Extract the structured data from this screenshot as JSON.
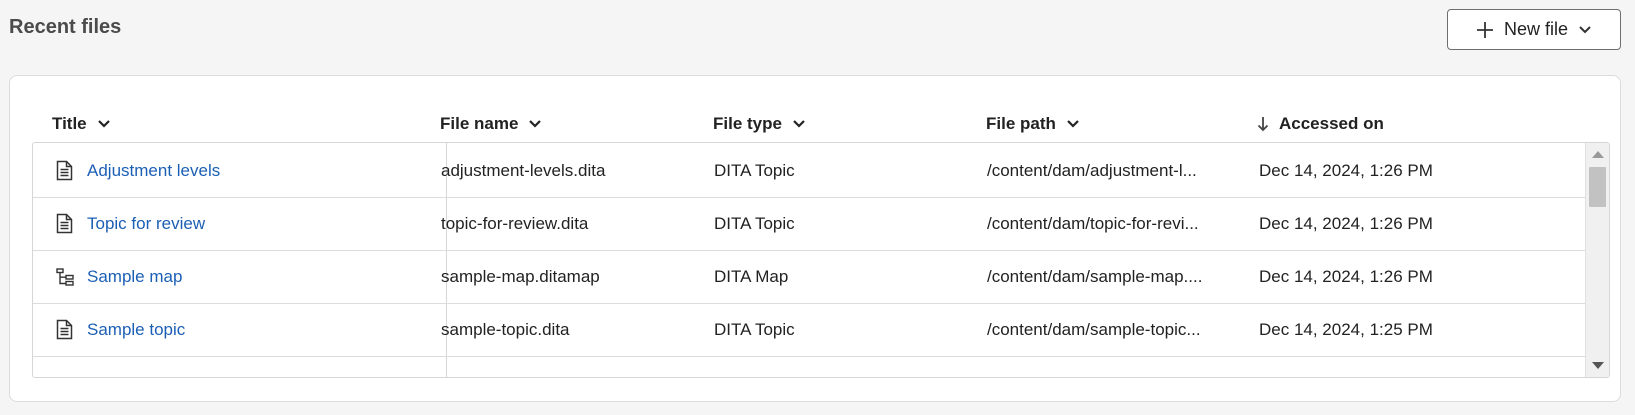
{
  "header": {
    "title": "Recent files",
    "new_file_label": "New file",
    "new_file_icon": "plus-icon",
    "new_file_dropdown_icon": "chevron-down-icon"
  },
  "table": {
    "columns": [
      {
        "label": "Title",
        "indicator": "chevron-down-icon"
      },
      {
        "label": "File name",
        "indicator": "chevron-down-icon"
      },
      {
        "label": "File type",
        "indicator": "chevron-down-icon"
      },
      {
        "label": "File path",
        "indicator": "chevron-down-icon"
      },
      {
        "label": "Accessed on",
        "indicator": "arrow-down-icon"
      }
    ],
    "rows": [
      {
        "icon": "document-icon",
        "title": "Adjustment levels",
        "file_name": "adjustment-levels.dita",
        "file_type": "DITA Topic",
        "file_path": "/content/dam/adjustment-l...",
        "accessed_on": "Dec 14, 2024, 1:26 PM"
      },
      {
        "icon": "document-icon",
        "title": "Topic for review",
        "file_name": "topic-for-review.dita",
        "file_type": "DITA Topic",
        "file_path": "/content/dam/topic-for-revi...",
        "accessed_on": "Dec 14, 2024, 1:26 PM"
      },
      {
        "icon": "map-tree-icon",
        "title": "Sample map",
        "file_name": "sample-map.ditamap",
        "file_type": "DITA Map",
        "file_path": "/content/dam/sample-map....",
        "accessed_on": "Dec 14, 2024, 1:26 PM"
      },
      {
        "icon": "document-icon",
        "title": "Sample topic",
        "file_name": "sample-topic.dita",
        "file_type": "DITA Topic",
        "file_path": "/content/dam/sample-topic...",
        "accessed_on": "Dec 14, 2024, 1:25 PM"
      }
    ]
  },
  "colors": {
    "link": "#1b5fb5",
    "border": "#dcdcdc",
    "background": "#f5f5f5"
  }
}
